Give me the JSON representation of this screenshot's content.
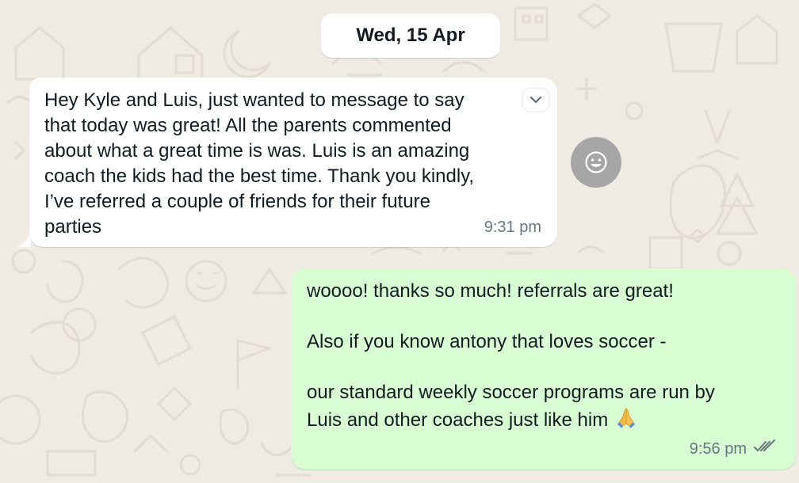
{
  "date_divider": "Wed, 15 Apr",
  "messages": [
    {
      "direction": "incoming",
      "text": "Hey Kyle and Luis, just wanted to message to say\nthat today was great! All the parents commented\nabout what a great time is was. Luis is an amazing\ncoach the kids had the best time. Thank you kindly,\nI’ve referred a couple of friends for their future\nparties",
      "time": "9:31 pm",
      "menu_icon": "chevron-down-icon",
      "reaction_icon": "smiley-icon"
    },
    {
      "direction": "outgoing",
      "text": "woooo! thanks so much! referrals are great!\n\nAlso if you know antony that loves soccer -\n\nour standard weekly soccer programs are run by\nLuis and other coaches just like him",
      "emoji": "pray-emoji",
      "time": "9:56 pm",
      "status_icon": "double-check-icon",
      "status": "delivered"
    }
  ],
  "colors": {
    "background": "#efeae2",
    "incoming_bubble": "#ffffff",
    "outgoing_bubble": "#d9fdd3",
    "text": "#111b21",
    "meta_text": "#667781",
    "reaction_button": "#a6a6a6"
  }
}
